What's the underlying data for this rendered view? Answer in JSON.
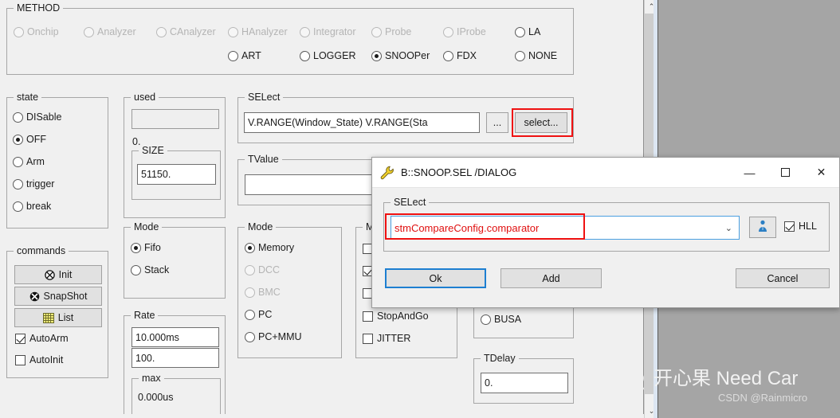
{
  "method": {
    "legend": "METHOD",
    "row1": [
      {
        "label": "Onchip",
        "selected": false,
        "disabled": true
      },
      {
        "label": "Analyzer",
        "selected": false,
        "disabled": true
      },
      {
        "label": "CAnalyzer",
        "selected": false,
        "disabled": true
      },
      {
        "label": "HAnalyzer",
        "selected": false,
        "disabled": true
      },
      {
        "label": "Integrator",
        "selected": false,
        "disabled": true
      },
      {
        "label": "Probe",
        "selected": false,
        "disabled": true
      },
      {
        "label": "IProbe",
        "selected": false,
        "disabled": true
      },
      {
        "label": "LA",
        "selected": false,
        "disabled": false
      }
    ],
    "row2": [
      {
        "label": "ART",
        "selected": false,
        "disabled": false
      },
      {
        "label": "LOGGER",
        "selected": false,
        "disabled": false
      },
      {
        "label": "SNOOPer",
        "selected": true,
        "disabled": false
      },
      {
        "label": "FDX",
        "selected": false,
        "disabled": false
      },
      {
        "label": "NONE",
        "selected": false,
        "disabled": false
      }
    ]
  },
  "state": {
    "legend": "state",
    "options": [
      {
        "label": "DISable",
        "selected": false
      },
      {
        "label": "OFF",
        "selected": true
      },
      {
        "label": "Arm",
        "selected": false
      },
      {
        "label": "trigger",
        "selected": false
      },
      {
        "label": "break",
        "selected": false
      }
    ]
  },
  "commands": {
    "legend": "commands",
    "buttons": [
      {
        "label": "Init",
        "icon": "circle-x-outline-icon"
      },
      {
        "label": "SnapShot",
        "icon": "circle-x-filled-icon"
      },
      {
        "label": "List",
        "icon": "grid-list-icon"
      }
    ],
    "checks": [
      {
        "label": "AutoArm",
        "checked": true
      },
      {
        "label": "AutoInit",
        "checked": false
      }
    ]
  },
  "used": {
    "legend": "used",
    "bar_value": "",
    "value_text": "0.",
    "size": {
      "legend": "SIZE",
      "value": "51150."
    }
  },
  "mode_fifo": {
    "legend": "Mode",
    "options": [
      {
        "label": "Fifo",
        "selected": true
      },
      {
        "label": "Stack",
        "selected": false
      }
    ]
  },
  "rate": {
    "legend": "Rate",
    "value1": "10.000ms",
    "value2": "100.",
    "max": {
      "legend": "max",
      "value": "0.000us"
    }
  },
  "select_group": {
    "legend": "SELect",
    "value": "V.RANGE(Window_State) V.RANGE(Sta",
    "dots_label": "...",
    "select_label": "select..."
  },
  "tvalue": {
    "legend": "TValue",
    "value": ""
  },
  "mode_memory": {
    "legend": "Mode",
    "options": [
      {
        "label": "Memory",
        "selected": true,
        "disabled": false
      },
      {
        "label": "DCC",
        "selected": false,
        "disabled": true
      },
      {
        "label": "BMC",
        "selected": false,
        "disabled": true
      },
      {
        "label": "PC",
        "selected": false,
        "disabled": false
      },
      {
        "label": "PC+MMU",
        "selected": false,
        "disabled": false
      }
    ]
  },
  "options_group": {
    "legend": "M",
    "checks": [
      {
        "label": "",
        "checked": false
      },
      {
        "label": "",
        "checked": true
      },
      {
        "label": "",
        "checked": false
      },
      {
        "label": "StopAndGo",
        "checked": false
      },
      {
        "label": "JITTER",
        "checked": false
      }
    ]
  },
  "bus_group": {
    "options": [
      {
        "label": "BUSA",
        "selected": false
      }
    ]
  },
  "tdelay": {
    "legend": "TDelay",
    "value": "0."
  },
  "dialog": {
    "title": "B::SNOOP.SEL /DIALOG",
    "icon": "wrench-icon",
    "window_controls": {
      "minimize": "—",
      "maximize": "☐",
      "close": "✕"
    },
    "select": {
      "legend": "SELect",
      "value": "stmCompareConfig.comparator",
      "chevron": "⌄",
      "info_icon": "info-person-icon",
      "hll": {
        "label": "HLL",
        "checked": true
      }
    },
    "buttons": {
      "ok": "Ok",
      "add": "Add",
      "cancel": "Cancel"
    }
  },
  "scrollbar": {
    "up_arrow": "⌃",
    "down_arrow": "⌄"
  },
  "watermark": {
    "icon": "wechat-icon",
    "text": "开心果 Need Car",
    "subtext": "CSDN @Rainmicro"
  },
  "colors": {
    "accent_red": "#ef1111",
    "focus_blue": "#1d7fd1",
    "panel_bg": "#f0f0f0",
    "desktop_bg": "#a5a5a5"
  }
}
